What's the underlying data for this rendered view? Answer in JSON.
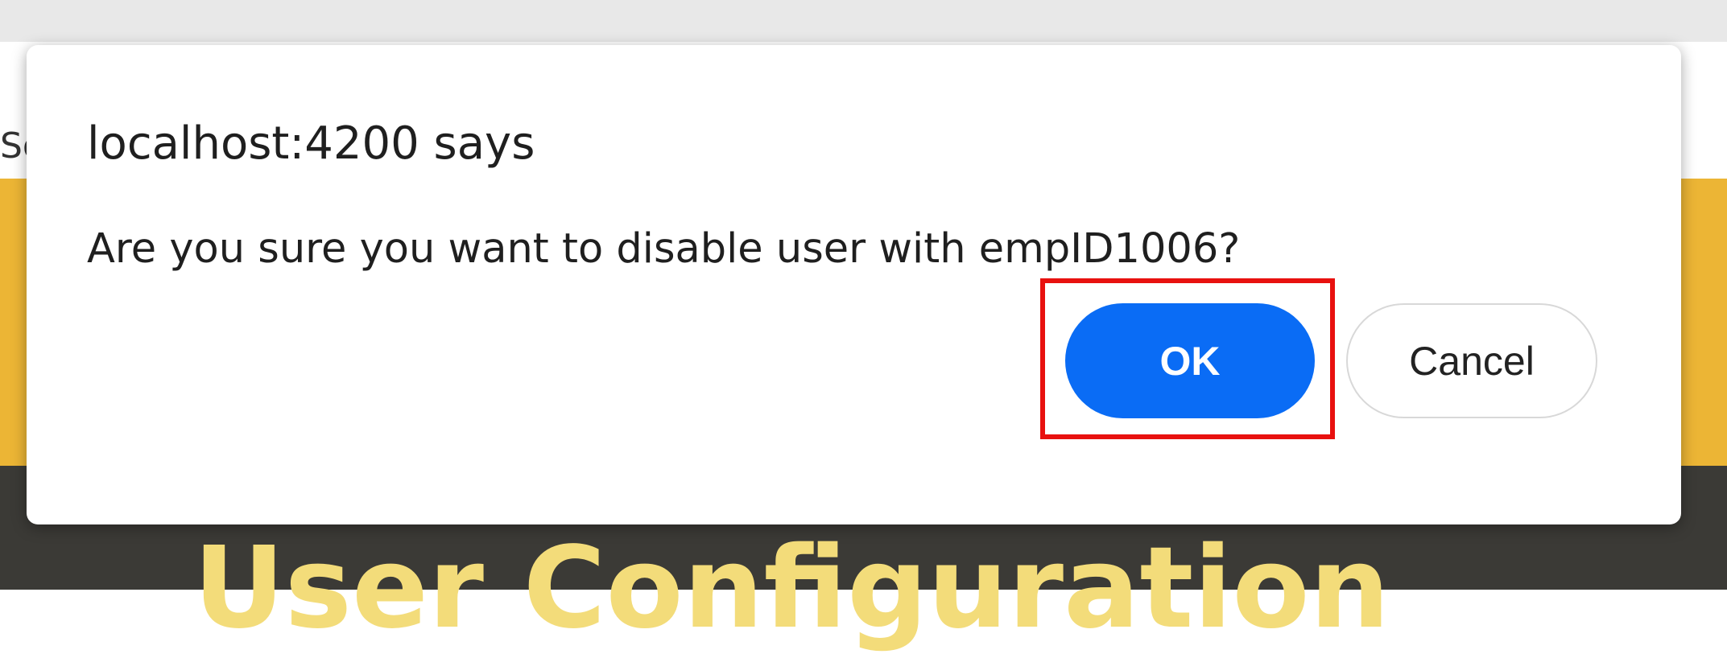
{
  "page": {
    "toolbar_partial_text": "So",
    "heading": "User Configuration"
  },
  "dialog": {
    "title": "localhost:4200 says",
    "message": "Are you sure you want to disable user with empID1006?",
    "ok_label": "OK",
    "cancel_label": "Cancel"
  },
  "colors": {
    "ok_button": "#0a6cf5",
    "highlight": "#e8110f",
    "banner_yellow": "#ecb535",
    "banner_dark": "#3b3a36",
    "heading_yellow": "#f3dc7a"
  }
}
